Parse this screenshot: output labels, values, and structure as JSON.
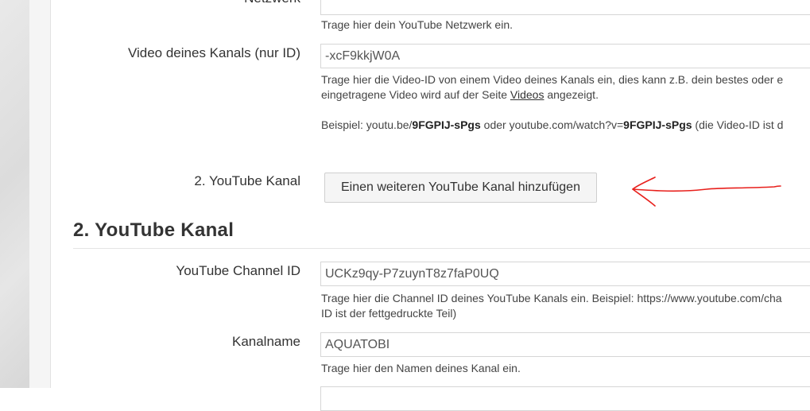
{
  "network": {
    "label": "Netzwerk",
    "help": "Trage hier dein YouTube Netzwerk ein."
  },
  "video": {
    "label": "Video deines Kanals (nur ID)",
    "value": "-xcF9kkjW0A",
    "help_line1": "Trage hier die Video-ID von einem Video deines Kanals ein, dies kann z.B. dein bestes oder e",
    "help_line2_pre": "eingetragene Video wird auf der Seite ",
    "help_link": "Videos",
    "help_line2_post": " angezeigt.",
    "example_pre": "Beispiel: youtu.be/",
    "example_id1": "9FGPIJ-sPgs",
    "example_mid": " oder youtube.com/watch?v=",
    "example_id2": "9FGPIJ-sPgs",
    "example_post": " (die Video-ID ist d"
  },
  "second_channel": {
    "label": "2. YouTube Kanal",
    "button": "Einen weiteren YouTube Kanal hinzufügen"
  },
  "section": {
    "title": "2. YouTube Kanal"
  },
  "channel_id": {
    "label": "YouTube Channel ID",
    "value": "UCKz9qy-P7zuynT8z7faP0UQ",
    "help_line1": "Trage hier die Channel ID deines YouTube Kanals ein. Beispiel: https://www.youtube.com/cha",
    "help_line2": "ID ist der fettgedruckte Teil)"
  },
  "channel_name": {
    "label": "Kanalname",
    "value": "AQUATOBI",
    "help": "Trage hier den Namen deines Kanal ein."
  },
  "colors": {
    "annotation_arrow": "#e8201c"
  }
}
